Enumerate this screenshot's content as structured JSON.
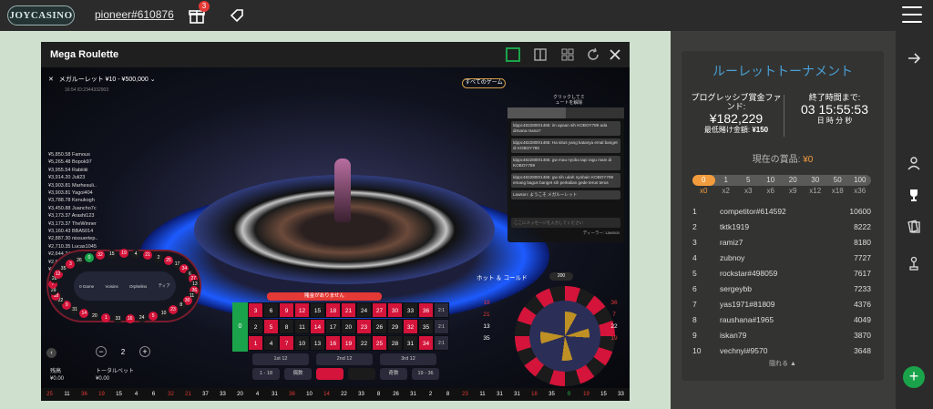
{
  "topbar": {
    "logo_text": "JOYCASINO",
    "username": "pioneer#610876",
    "gift_badge": "3"
  },
  "game": {
    "title": "Mega Roulette",
    "header": "メガルーレット ¥10 - ¥500,000",
    "sub": "16:54  ID:2344332903",
    "all_games_btn": "すべてのゲーム",
    "chat_tip_line1": "クリックしてミ",
    "chat_tip_line2": "ュートを解除",
    "winners": [
      "¥5,850.58 Famous",
      "¥5,265.48 Bopok97",
      "¥3,955.54 Rabiiiiii",
      "¥3,914.20 Juli23",
      "¥3,903.81 Marhesuli..",
      "¥3,903.81 Yagoi404",
      "¥3,788.78 Kenukogh",
      "¥3,450.88 Juancho7c",
      "¥3,173.37 Arashi123",
      "¥3,173.37 TheWinner",
      "¥3,160.43 BBA5014",
      "¥2,887.30 nissuertep..",
      "¥2,710.35 Lucas1045",
      "¥2,644.24 loiafaala",
      "¥2,644.24 Aoll23",
      "¥2,644.24 doaemon"
    ],
    "chat_messages": [
      "ldppc4822800!1465: im apaan sih KOBOY789 ada dimana mana?",
      "ldppc4822800!1465: Ha situs yang katanya emal banget di KOBOY789",
      "ldppc4822800!1465: gw mau nyoba tapi ragu main di KOBOY789",
      "ldppc4822800!1465: gw sih udah nyobain KOBOY789 emang bagus banget sih perkalian gede terus terus",
      "Lawson: ようこそ メガルーレット"
    ],
    "chat_placeholder": "ここにメッセージを入力してください",
    "chat_dealer": "ディーラー: Lawson",
    "banner": "賭金がありません",
    "race_labels": [
      "0 Game",
      "Voisins",
      "Orphelins",
      "ティア"
    ],
    "race_numbers": [
      "19",
      "4",
      "21",
      "2",
      "25",
      "17",
      "34",
      "6",
      "27",
      "13",
      "36",
      "11",
      "30",
      "8",
      "23",
      "10",
      "5",
      "24",
      "16",
      "33",
      "1",
      "20",
      "14",
      "31",
      "9",
      "22",
      "18",
      "29",
      "7",
      "28",
      "12",
      "35",
      "3",
      "26",
      "0",
      "32",
      "15"
    ],
    "grid_rows": [
      [
        "3",
        "6",
        "9",
        "12",
        "15",
        "18",
        "21",
        "24",
        "27",
        "30",
        "33",
        "36"
      ],
      [
        "2",
        "5",
        "8",
        "11",
        "14",
        "17",
        "20",
        "23",
        "26",
        "29",
        "32",
        "35"
      ],
      [
        "1",
        "4",
        "7",
        "10",
        "13",
        "16",
        "19",
        "22",
        "25",
        "28",
        "31",
        "34"
      ]
    ],
    "col_label": "2:1",
    "zero": "0",
    "dozens": [
      "1st 12",
      "2nd 12",
      "3rd 12"
    ],
    "outside": [
      "1 - 18",
      "偶数",
      "",
      "",
      "奇数",
      "19 - 36"
    ],
    "stepper_value": "2",
    "balance_label": "残高",
    "balance_value": "¥0.00",
    "total_bet_label": "トータルベット",
    "total_bet_value": "¥0.00",
    "hotcold_title": "ホット ＆ コールド",
    "hc_toggle": "200",
    "hot_numbers": [
      "18",
      "21",
      "13",
      "35"
    ],
    "cold_numbers": [
      "36",
      "7",
      "22",
      "19"
    ],
    "history": [
      "25",
      "11",
      "36",
      "19",
      "15",
      "4",
      "6",
      "32",
      "21",
      "37",
      "33",
      "20",
      "4",
      "31",
      "36",
      "10",
      "14",
      "22",
      "33",
      "8",
      "26",
      "31",
      "2",
      "8",
      "23",
      "11",
      "31",
      "31",
      "18",
      "35",
      "0",
      "19",
      "15",
      "33"
    ]
  },
  "tournament": {
    "title": "ルーレットトーナメント",
    "prize_label": "プログレッシブ賞金ファンド:",
    "prize_value": "¥182,229",
    "min_bet_label": "最低賭け金額:",
    "min_bet_value": "¥150",
    "end_label": "終了時間まで:",
    "end_value": "03 15:55:53",
    "end_units": "日  時  分  秒",
    "current_prize_label": "現在の賞品:",
    "current_prize_value": "¥0",
    "multipliers": [
      "0",
      "1",
      "5",
      "10",
      "20",
      "30",
      "50",
      "100"
    ],
    "x_labels": [
      "x0",
      "x2",
      "x3",
      "x6",
      "x9",
      "x12",
      "x18",
      "x36"
    ],
    "leaderboard": [
      {
        "pos": "1",
        "name": "competitor#614592",
        "score": "10600"
      },
      {
        "pos": "2",
        "name": "tktk1919",
        "score": "8222"
      },
      {
        "pos": "3",
        "name": "ramiz7",
        "score": "8180"
      },
      {
        "pos": "4",
        "name": "zubnoy",
        "score": "7727"
      },
      {
        "pos": "5",
        "name": "rockstar#498059",
        "score": "7617"
      },
      {
        "pos": "6",
        "name": "sergeybb",
        "score": "7233"
      },
      {
        "pos": "7",
        "name": "yas1971#81809",
        "score": "4376"
      },
      {
        "pos": "8",
        "name": "raushana#1965",
        "score": "4049"
      },
      {
        "pos": "9",
        "name": "iskan79",
        "score": "3870"
      },
      {
        "pos": "10",
        "name": "vechnyi#9570",
        "score": "3648"
      }
    ],
    "hide_label": "隠れる ▲"
  },
  "colors": {
    "accent_orange": "#f39c3d",
    "accent_blue": "#4a9fd6",
    "green": "#1aa34a",
    "red": "#d4143a"
  }
}
